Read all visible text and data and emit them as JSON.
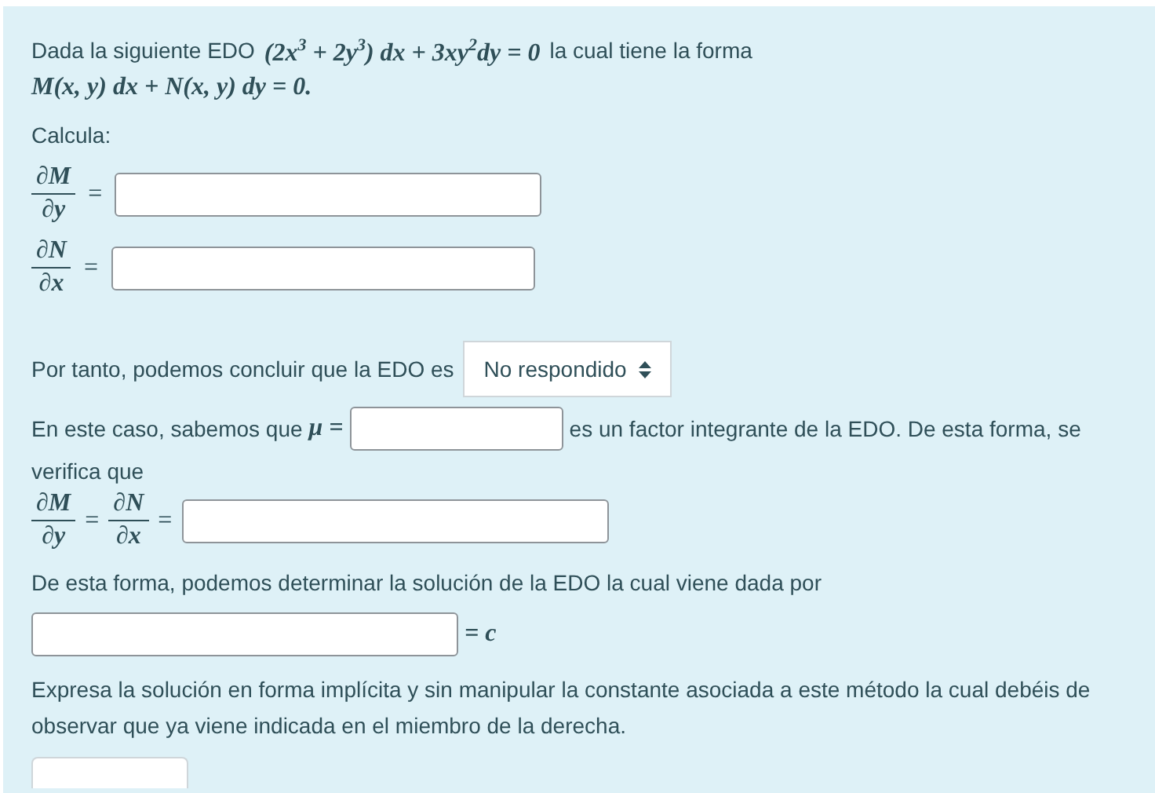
{
  "intro": {
    "text_before": "Dada la siguiente EDO",
    "equation": "(2x$^{3}$ + 2y$^{3}$) dx + 3xy$^{2}$dy = 0",
    "text_after": "la cual tiene la forma",
    "form": "M(x, y) dx + N(x, y) dy = 0."
  },
  "prompt": "Calcula:",
  "partials": [
    {
      "numerator": "∂M",
      "denominator": "∂y",
      "equals": "="
    },
    {
      "numerator": "∂N",
      "denominator": "∂x",
      "equals": "="
    }
  ],
  "conclusion": {
    "text": "Por tanto, podemos concluir que la EDO es",
    "select_value": "No respondido"
  },
  "factor": {
    "text_before": "En este caso, sabemos que",
    "symbol": "μ =",
    "text_after": "es un factor integrante de la EDO. De esta forma, se",
    "continuation": "verifica que"
  },
  "chain": [
    {
      "numerator": "∂M",
      "denominator": "∂y",
      "equals": "="
    },
    {
      "numerator": "∂N",
      "denominator": "∂x",
      "equals": "="
    }
  ],
  "solution": {
    "text": "De esta forma, podemos determinar la solución de la EDO la cual viene dada por",
    "rhs": "= c"
  },
  "note": "Expresa la solución en forma implícita y sin manipular la constante asociada a este método la cual debéis de observar que ya viene indicada en el miembro de la derecha."
}
